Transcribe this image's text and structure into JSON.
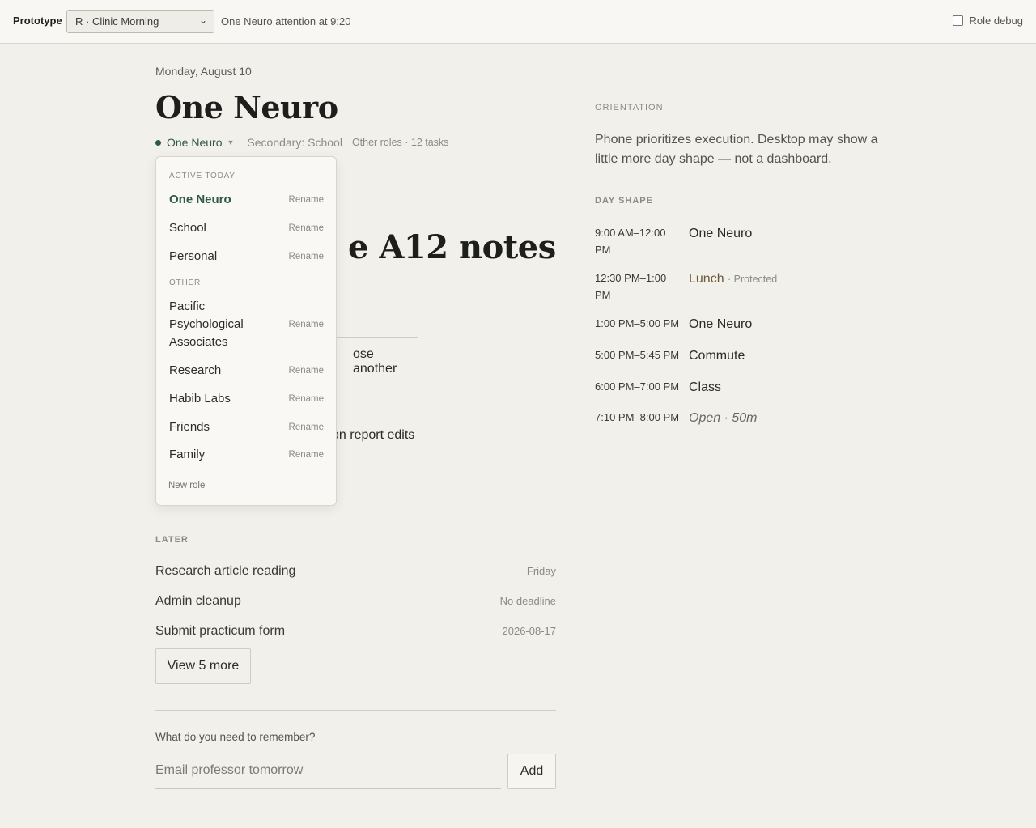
{
  "topbar": {
    "brand": "Prototype",
    "scenario": "R · Clinic Morning",
    "status": "One Neuro attention at 9:20",
    "debug_label": "Role debug"
  },
  "header": {
    "date": "Monday, August 10",
    "title": "One Neuro",
    "primary_role": "One Neuro",
    "secondary_role": "Secondary: School",
    "other_roles": "Other roles · 12 tasks"
  },
  "obscured": {
    "heading_fragment": "e A12 notes",
    "choose_fragment": "ose another",
    "line_fragment": "on report edits"
  },
  "role_menu": {
    "active_heading": "ACTIVE TODAY",
    "other_heading": "OTHER",
    "rename_label": "Rename",
    "new_role": "New role",
    "active": [
      "One Neuro",
      "School",
      "Personal"
    ],
    "other": [
      "Pacific Psychological Associates",
      "Research",
      "Habib Labs",
      "Friends",
      "Family"
    ]
  },
  "later": {
    "heading": "LATER",
    "items": [
      {
        "title": "Research article reading",
        "due": "Friday"
      },
      {
        "title": "Admin cleanup",
        "due": "No deadline"
      },
      {
        "title": "Submit practicum form",
        "due": "2026-08-17"
      }
    ],
    "more_button": "View 5 more"
  },
  "capture": {
    "label": "What do you need to remember?",
    "placeholder": "Email professor tomorrow",
    "add_button": "Add"
  },
  "orientation": {
    "heading": "ORIENTATION",
    "text": "Phone prioritizes execution. Desktop may show a little more day shape — not a dashboard."
  },
  "day_shape": {
    "heading": "DAY SHAPE",
    "blocks": [
      {
        "time": "9:00 AM–12:00 PM",
        "label": "One Neuro",
        "note": ""
      },
      {
        "time": "12:30 PM–1:00 PM",
        "label": "Lunch",
        "note": "· Protected"
      },
      {
        "time": "1:00 PM–5:00 PM",
        "label": "One Neuro",
        "note": ""
      },
      {
        "time": "5:00 PM–5:45 PM",
        "label": "Commute",
        "note": ""
      },
      {
        "time": "6:00 PM–7:00 PM",
        "label": "Class",
        "note": ""
      },
      {
        "time": "7:10 PM–8:00 PM",
        "label": "Open · 50m",
        "note": ""
      }
    ]
  },
  "colors": {
    "background": "#f2f0ea",
    "accent": "#2f5a45",
    "muted": "#8b8a85"
  }
}
